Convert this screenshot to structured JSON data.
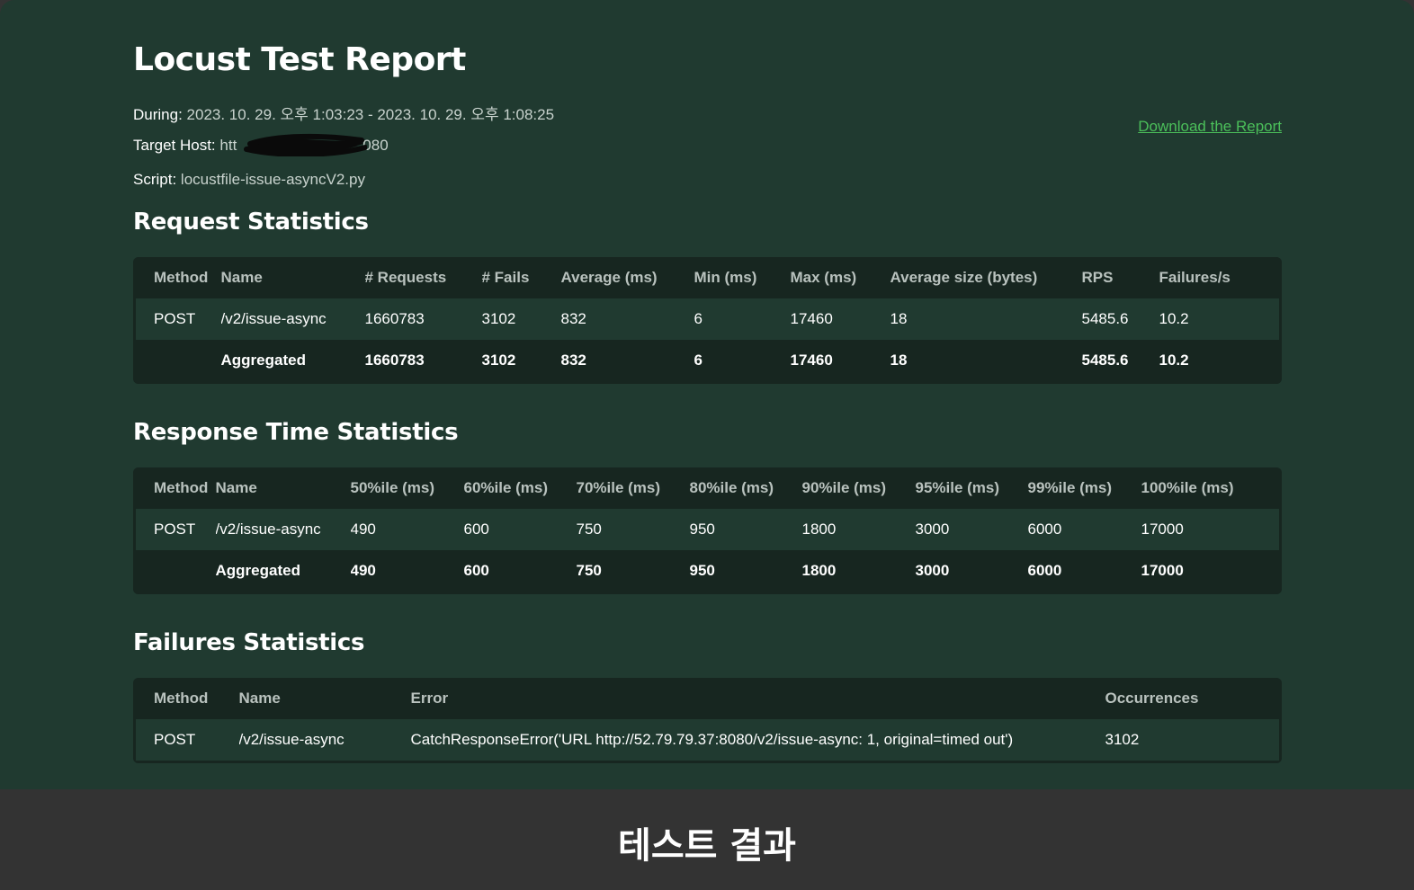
{
  "report": {
    "title": "Locust Test Report",
    "during_label": "During:",
    "during_value": "2023. 10. 29. 오후 1:03:23 - 2023. 10. 29. 오후 1:08:25",
    "host_label": "Target Host:",
    "host_value_start": "htt",
    "host_value_end": "080",
    "script_label": "Script:",
    "script_value": "locustfile-issue-asyncV2.py",
    "download_link": "Download the Report"
  },
  "request_stats": {
    "heading": "Request Statistics",
    "columns": [
      "Method",
      "Name",
      "# Requests",
      "# Fails",
      "Average (ms)",
      "Min (ms)",
      "Max (ms)",
      "Average size (bytes)",
      "RPS",
      "Failures/s"
    ],
    "rows": [
      [
        "POST",
        "/v2/issue-async",
        "1660783",
        "3102",
        "832",
        "6",
        "17460",
        "18",
        "5485.6",
        "10.2"
      ]
    ],
    "aggregated": [
      "",
      "Aggregated",
      "1660783",
      "3102",
      "832",
      "6",
      "17460",
      "18",
      "5485.6",
      "10.2"
    ]
  },
  "response_stats": {
    "heading": "Response Time Statistics",
    "columns": [
      "Method",
      "Name",
      "50%ile (ms)",
      "60%ile (ms)",
      "70%ile (ms)",
      "80%ile (ms)",
      "90%ile (ms)",
      "95%ile (ms)",
      "99%ile (ms)",
      "100%ile (ms)"
    ],
    "rows": [
      [
        "POST",
        "/v2/issue-async",
        "490",
        "600",
        "750",
        "950",
        "1800",
        "3000",
        "6000",
        "17000"
      ]
    ],
    "aggregated": [
      "",
      "Aggregated",
      "490",
      "600",
      "750",
      "950",
      "1800",
      "3000",
      "6000",
      "17000"
    ]
  },
  "failure_stats": {
    "heading": "Failures Statistics",
    "columns": [
      "Method",
      "Name",
      "Error",
      "Occurrences"
    ],
    "rows": [
      [
        "POST",
        "/v2/issue-async",
        "CatchResponseError('URL http://52.79.79.37:8080/v2/issue-async: 1, original=timed out')",
        "3102"
      ]
    ]
  },
  "caption": "테스트 결과"
}
